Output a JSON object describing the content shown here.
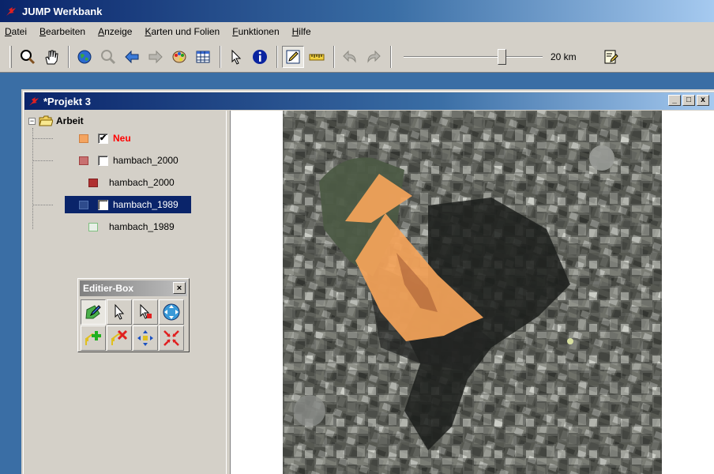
{
  "app": {
    "title": "JUMP Werkbank",
    "menu": [
      "Datei",
      "Bearbeiten",
      "Anzeige",
      "Karten und Folien",
      "Funktionen",
      "Hilfe"
    ],
    "scale_label": "20 km",
    "zoom_level": 0.72
  },
  "project": {
    "title": "*Projekt 3",
    "controls": {
      "minimize": "_",
      "maximize": "□",
      "close": "x"
    }
  },
  "layers": {
    "category": "Arbeit",
    "expander": "−",
    "items": [
      {
        "label": "Neu",
        "checked": true,
        "color": "#f4a460",
        "highlight": true
      },
      {
        "label": "hambach_2000",
        "checked": false,
        "color": "#c87070"
      },
      {
        "label": "hambach_2000",
        "style_color": "#b03030"
      },
      {
        "label": "hambach_1989",
        "checked": true,
        "color": "#2e4b8c",
        "selected": true
      },
      {
        "label": "hambach_1989",
        "style_color": "#7fbf7f"
      }
    ],
    "check_mark": "✔"
  },
  "editbox": {
    "title": "Editier-Box",
    "close": "×"
  },
  "colors": {
    "titlebar": "#0a246a",
    "face": "#d4d0c8",
    "accent_red": "#ff0000",
    "polygon_fill": "#f5a45a"
  }
}
